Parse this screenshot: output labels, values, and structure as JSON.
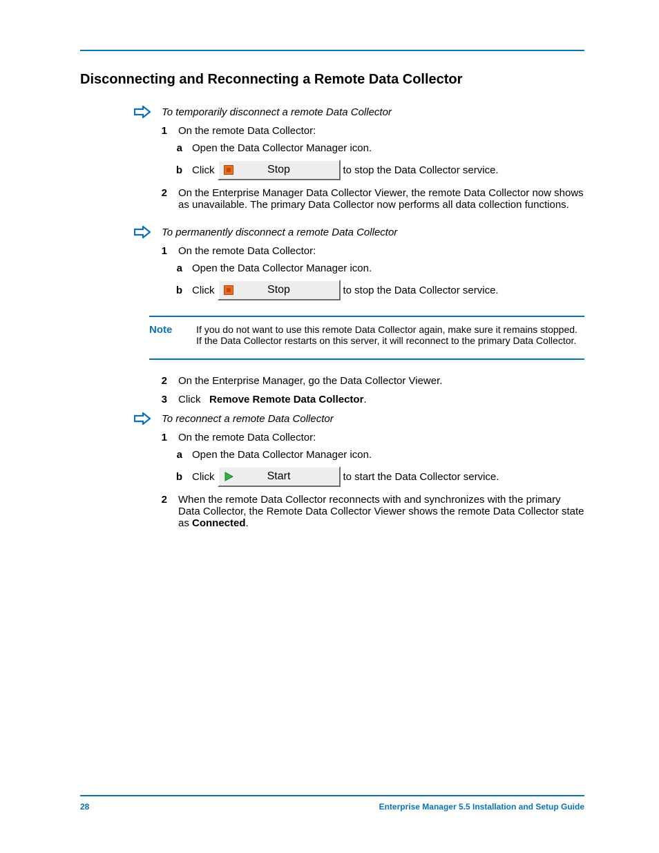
{
  "section_title": "Disconnecting and Reconnecting a Remote Data Collector",
  "buttons": {
    "stop": "Stop",
    "start": "Start"
  },
  "proc1": {
    "title": "To temporarily disconnect a remote Data Collector",
    "s1": "On the remote Data Collector:",
    "s1a": "Open the Data Collector Manager icon.",
    "s1b_pre": "Click",
    "s1b_post": "to stop the Data Collector service.",
    "s2": "On the Enterprise Manager Data Collector Viewer, the remote Data Collector now shows as unavailable. The primary Data Collector now performs all data collection functions."
  },
  "proc2": {
    "title": "To permanently disconnect a remote Data Collector",
    "s1": "On the remote Data Collector:",
    "s1a": "Open the Data Collector Manager icon.",
    "s1b_pre": "Click",
    "s1b_post": "to stop the Data Collector service.",
    "note_label": "Note",
    "note_text": "If you do not want to use this remote Data Collector again, make sure it remains stopped. If the Data Collector restarts on this server, it will reconnect to the primary Data Collector.",
    "s2": "On the Enterprise Manager, go the Data Collector Viewer.",
    "s3_pre": "Click",
    "s3_bold": "Remove Remote Data Collector",
    "s3_post": "."
  },
  "proc3": {
    "title": "To reconnect a remote Data Collector",
    "s1": "On the remote Data Collector:",
    "s1a": "Open the Data Collector Manager icon.",
    "s1b_pre": "Click",
    "s1b_post": "to start the Data Collector service.",
    "s2_pre": "When the remote Data Collector reconnects with and synchronizes with the primary Data Collector, the Remote Data Collector Viewer shows the remote Data Collector state as ",
    "s2_bold": "Connected",
    "s2_post": "."
  },
  "footer": {
    "page": "28",
    "doc": "Enterprise Manager 5.5 Installation and Setup Guide"
  }
}
